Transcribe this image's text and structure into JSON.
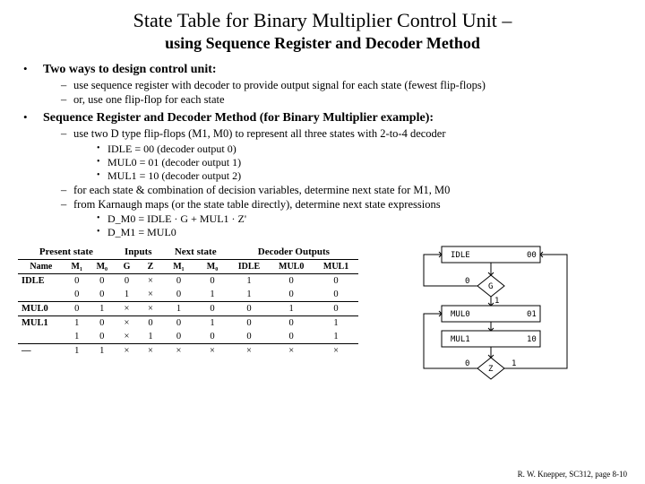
{
  "title_line1": "State Table for Binary Multiplier Control Unit –",
  "title_line2": "using Sequence Register and Decoder Method",
  "section1": {
    "heading": "Two ways to design control unit:",
    "items": [
      "use sequence register with decoder to provide output signal for each state (fewest flip-flops)",
      "or, use one flip-flop for each state"
    ]
  },
  "section2": {
    "heading": "Sequence Register and Decoder Method (for Binary Multiplier example):",
    "item1": "use two D type flip-flops (M1, M0) to represent all three states with 2-to-4 decoder",
    "sub1": [
      "IDLE = 00 (decoder output 0)",
      "MUL0 = 01 (decoder output 1)",
      "MUL1 = 10 (decoder output 2)"
    ],
    "item2": "for each state & combination of decision variables, determine next state for M1, M0",
    "item3": "from Karnaugh maps (or the state table directly), determine next state expressions",
    "sub3": [
      "D_M0 = IDLE · G + MUL1 · Z'",
      "D_M1 = MUL0"
    ]
  },
  "table": {
    "group_headers": [
      "Present state",
      "Inputs",
      "Next state",
      "Decoder Outputs"
    ],
    "col_headers": [
      "Name",
      "M₁",
      "M₀",
      "G",
      "Z",
      "M₁",
      "M₀",
      "IDLE",
      "MUL0",
      "MUL1"
    ],
    "rows": [
      [
        "IDLE",
        "0",
        "0",
        "0",
        "×",
        "0",
        "0",
        "1",
        "0",
        "0"
      ],
      [
        "",
        "0",
        "0",
        "1",
        "×",
        "0",
        "1",
        "1",
        "0",
        "0"
      ],
      [
        "MUL0",
        "0",
        "1",
        "×",
        "×",
        "1",
        "0",
        "0",
        "1",
        "0"
      ],
      [
        "MUL1",
        "1",
        "0",
        "×",
        "0",
        "0",
        "1",
        "0",
        "0",
        "1"
      ],
      [
        "",
        "1",
        "0",
        "×",
        "1",
        "0",
        "0",
        "0",
        "0",
        "1"
      ],
      [
        "—",
        "1",
        "1",
        "×",
        "×",
        "×",
        "×",
        "×",
        "×",
        "×"
      ]
    ]
  },
  "flow": {
    "idle": "IDLE",
    "idle_code": "00",
    "g": "G",
    "mul0": "MUL0",
    "mul0_code": "01",
    "mul1": "MUL1",
    "mul1_code": "10",
    "z": "Z",
    "zero": "0",
    "one": "1"
  },
  "credit": "R. W. Knepper, SC312, page 8-10"
}
